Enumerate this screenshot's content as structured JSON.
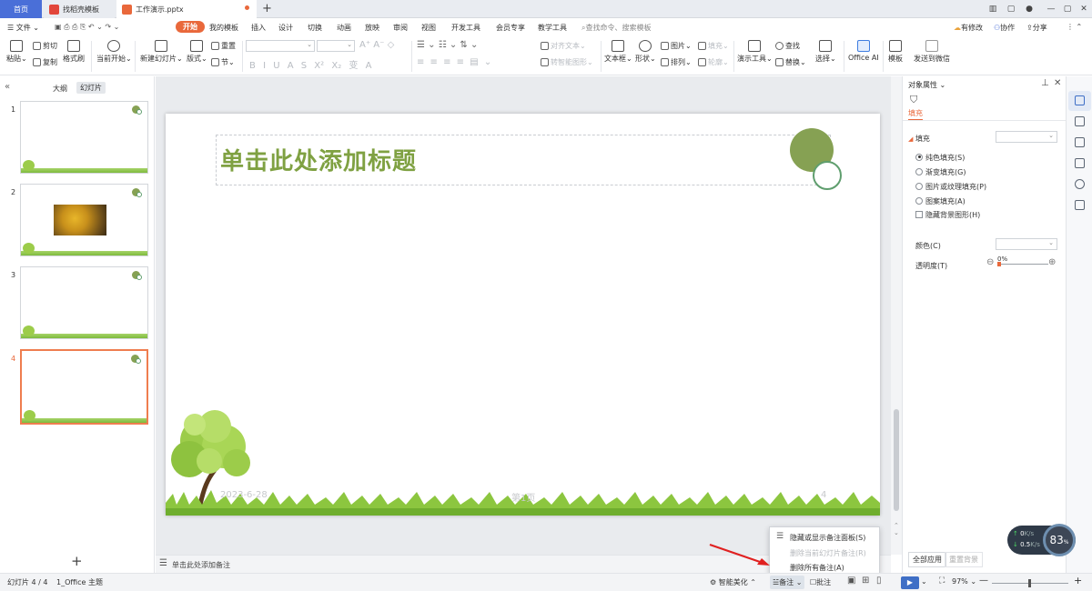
{
  "tabbar": {
    "tabs": [
      {
        "label": "首页"
      },
      {
        "label": "找稻壳模板"
      },
      {
        "label": "工作演示.pptx"
      }
    ],
    "new_tab": "+",
    "window_buttons": [
      "1⃣",
      "▢",
      "—",
      "▢",
      "✕"
    ]
  },
  "menu": {
    "file": "文件",
    "items": [
      "开始",
      "我的模板",
      "插入",
      "设计",
      "切换",
      "动画",
      "放映",
      "审阅",
      "视图",
      "开发工具",
      "会员专享",
      "教学工具"
    ],
    "search_placeholder": "查找命令、搜索模板",
    "right": [
      "有修改",
      "协作",
      "分享"
    ]
  },
  "ribbon": {
    "paste": "粘贴",
    "cut": "剪切",
    "copy": "复制",
    "format_painter": "格式刷",
    "from_current": "当前开始",
    "new_slide": "新建幻灯片",
    "layout": "版式",
    "reset": "重置",
    "section": "节",
    "align_text": "对齐文本",
    "smart_shape": "转智能图形",
    "textbox": "文本框",
    "shape": "形状",
    "picture": "图片",
    "arrange": "排列",
    "fill": "填充",
    "outline": "轮廓",
    "present_tools": "演示工具",
    "find": "查找",
    "replace": "替换",
    "select": "选择",
    "office_ai": "Office AI",
    "template": "模板",
    "send_wechat": "发送到微信",
    "format_glyphs": [
      "B",
      "I",
      "U",
      "A",
      "S",
      "X²",
      "X₂",
      "变",
      "A"
    ]
  },
  "left_panel": {
    "tabs": [
      "大纲",
      "幻灯片"
    ],
    "slide_numbers": [
      "1",
      "2",
      "3",
      "4"
    ],
    "add_slide": "+"
  },
  "slide": {
    "title": "单击此处添加标题",
    "date": "2023-6-28",
    "page": "第1页",
    "slide_number": "4"
  },
  "notes_placeholder": "单击此处添加备注",
  "right_panel": {
    "header": "对象属性",
    "tab": "填充",
    "section": "填充",
    "options": [
      "纯色填充(S)",
      "渐变填充(G)",
      "图片或纹理填充(P)",
      "图案填充(A)"
    ],
    "hide_bg": "隐藏背景图形(H)",
    "color_label": "颜色(C)",
    "transparency_label": "透明度(T)",
    "transparency_value": "0%",
    "apply_all": "全部应用",
    "reset_bg": "重置背景"
  },
  "popup_menu": {
    "items": [
      "隐藏或显示备注面板(S)",
      "删除当前幻灯片备注(R)",
      "删除所有备注(A)"
    ]
  },
  "status_bar": {
    "slide_info": "幻灯片 4 / 4",
    "theme": "1_Office 主题",
    "smart_beautify": "智能美化",
    "notes": "备注",
    "comments": "批注",
    "zoom": "97%"
  },
  "speed_widget": {
    "up": "0",
    "up_unit": "K/s",
    "down": "0.5",
    "down_unit": "K/s",
    "value": "83",
    "unit": "%"
  },
  "colors": {
    "accent": "#e9683b",
    "title_green": "#7fa142",
    "home_tab": "#4a6fd8"
  }
}
